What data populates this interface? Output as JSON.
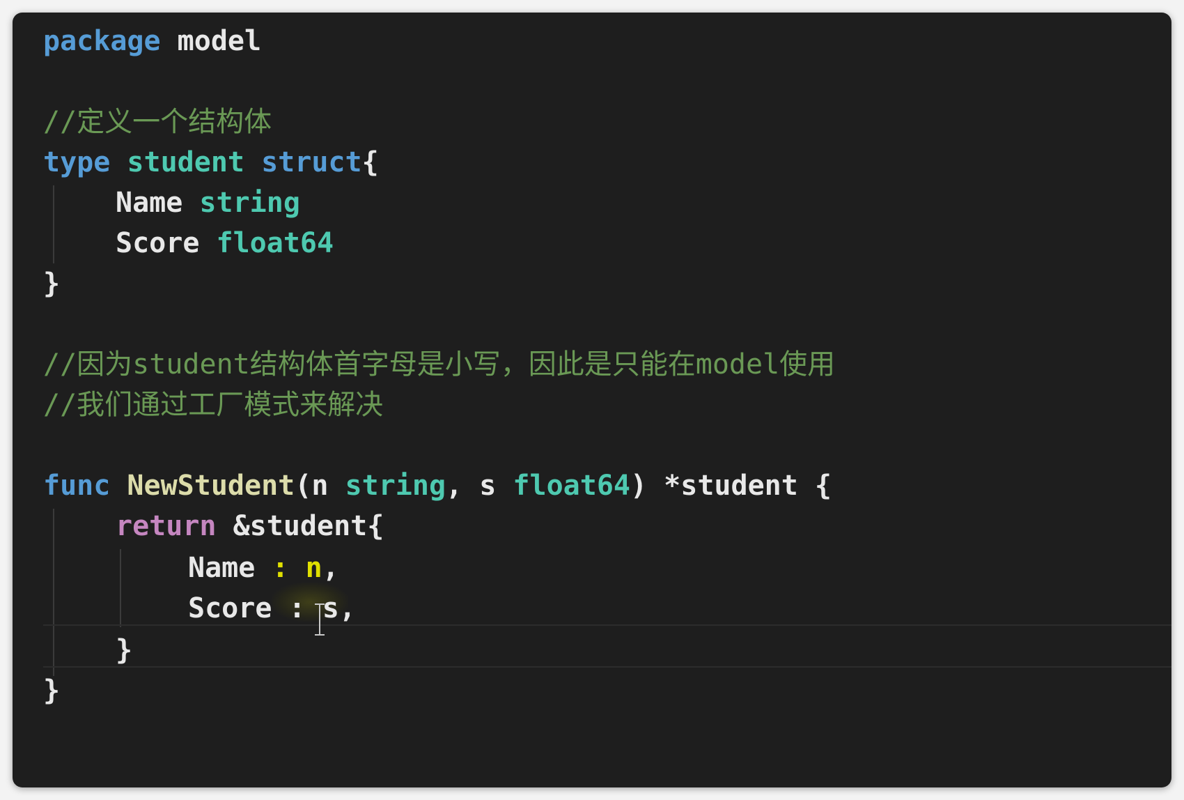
{
  "editor": {
    "language": "go",
    "theme_colors": {
      "background": "#1e1e1e",
      "keyword": "#569cd6",
      "type": "#4ec9b0",
      "function": "#dcdcaa",
      "control": "#c586c0",
      "comment": "#6a9955",
      "text": "#e8e8e8"
    },
    "line_package": {
      "kw": "package",
      "name": "model"
    },
    "comment_define": "//定义一个结构体",
    "line_type": {
      "kw": "type",
      "name": "student",
      "kw2": "struct",
      "brace": "{"
    },
    "field_name": {
      "name": "Name",
      "type": "string"
    },
    "field_score": {
      "name": "Score",
      "type": "float64"
    },
    "close_brace_1": "}",
    "comment_line_1": "//因为student结构体首字母是小写，因此是只能在model使用",
    "comment_line_2": "//我们通过工厂模式来解决",
    "line_func": {
      "kw": "func",
      "fname": "NewStudent",
      "open": "(",
      "p1": "n",
      "t1": "string",
      "comma": ",",
      "p2": "s",
      "t2": "float64",
      "close": ")",
      "ret": "*student",
      "brace": "{"
    },
    "line_return": {
      "kw": "return",
      "expr": "&student{"
    },
    "init_name": {
      "key": "Name",
      "colon": ":",
      "value": "n",
      "comma": ","
    },
    "init_score": {
      "key": "Score",
      "sep": ":",
      "value": "s",
      "comma": ","
    },
    "close_brace_inner": "}",
    "close_brace_func": "}"
  }
}
